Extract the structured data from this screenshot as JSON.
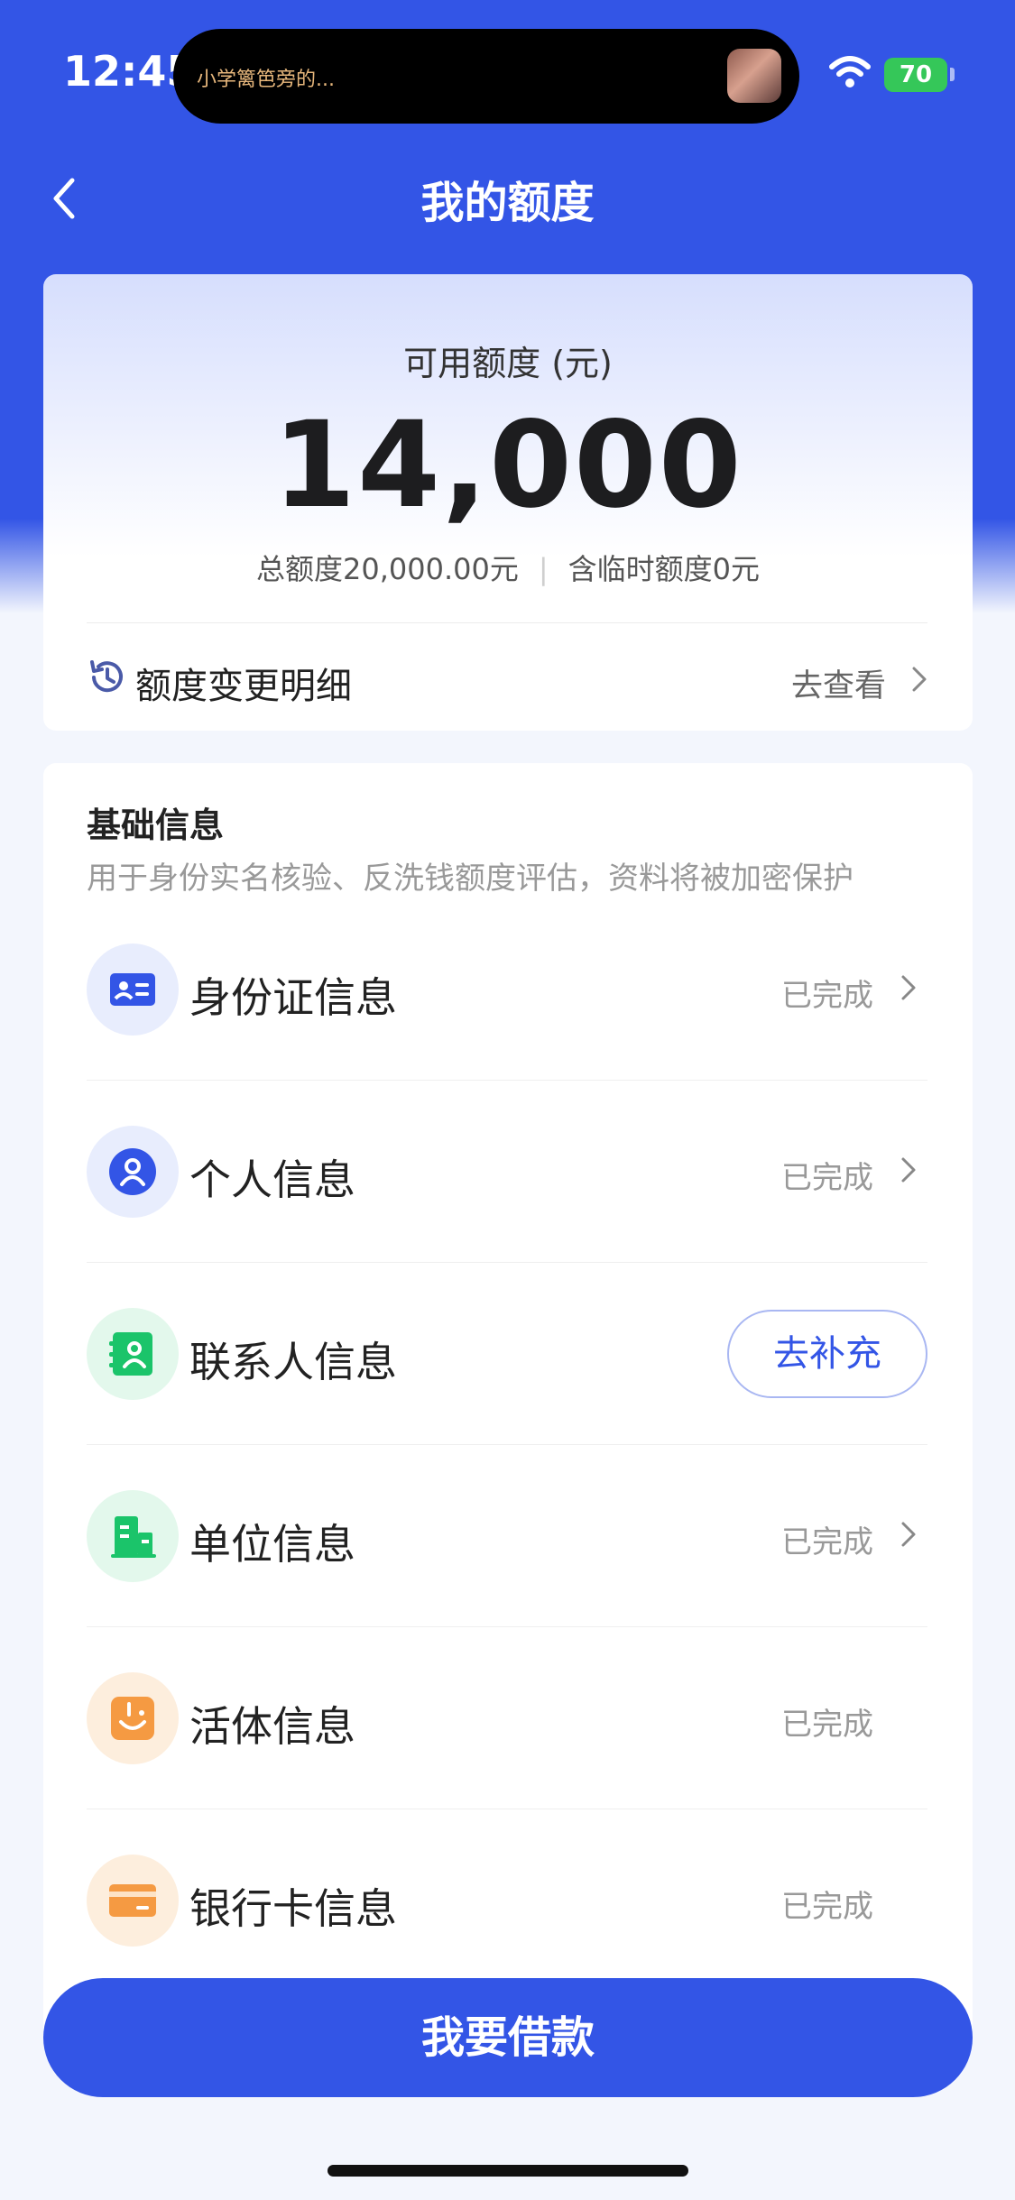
{
  "status_bar": {
    "time": "12:45",
    "live_activity_text": "小学篱笆旁的...",
    "battery": "70"
  },
  "nav": {
    "title": "我的额度"
  },
  "credit": {
    "label": "可用额度 (元)",
    "amount": "14,000",
    "total": "总额度20,000.00元",
    "separator": "|",
    "temporary": "含临时额度0元",
    "history_label": "额度变更明细",
    "history_link": "去查看"
  },
  "info": {
    "title": "基础信息",
    "description": "用于身份实名核验、反洗钱额度评估，资料将被加密保护",
    "items": [
      {
        "label": "身份证信息",
        "status": "已完成",
        "icon": "id-card-icon"
      },
      {
        "label": "个人信息",
        "status": "已完成",
        "icon": "person-icon"
      },
      {
        "label": "联系人信息",
        "action": "去补充",
        "icon": "contacts-icon"
      },
      {
        "label": "单位信息",
        "status": "已完成",
        "icon": "building-icon"
      },
      {
        "label": "活体信息",
        "status": "已完成",
        "icon": "face-icon"
      },
      {
        "label": "银行卡信息",
        "status": "已完成",
        "icon": "bank-card-icon"
      }
    ]
  },
  "loan_button": "我要借款",
  "colors": {
    "primary": "#3355e6",
    "battery": "#35c759",
    "id_icon_bg": "#e8edfd",
    "contact_icon_bg": "#e3f8ec",
    "face_icon_bg": "#fdeedd"
  }
}
